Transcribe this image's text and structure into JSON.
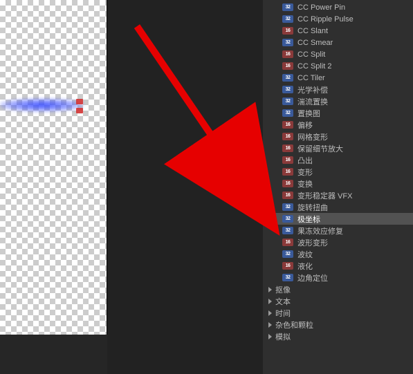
{
  "effects": [
    {
      "badge": "32",
      "label": "CC Power Pin"
    },
    {
      "badge": "32",
      "label": "CC Ripple Pulse"
    },
    {
      "badge": "16",
      "label": "CC Slant"
    },
    {
      "badge": "32",
      "label": "CC Smear"
    },
    {
      "badge": "16",
      "label": "CC Split"
    },
    {
      "badge": "16",
      "label": "CC Split 2"
    },
    {
      "badge": "32",
      "label": "CC Tiler"
    },
    {
      "badge": "32",
      "label": "光学补偿"
    },
    {
      "badge": "32",
      "label": "湍流置换"
    },
    {
      "badge": "32",
      "label": "置换图"
    },
    {
      "badge": "16",
      "label": "偏移"
    },
    {
      "badge": "16",
      "label": "网格变形"
    },
    {
      "badge": "16",
      "label": "保留细节放大"
    },
    {
      "badge": "16",
      "label": "凸出"
    },
    {
      "badge": "16",
      "label": "变形"
    },
    {
      "badge": "16",
      "label": "变换"
    },
    {
      "badge": "16",
      "label": "变形稳定器 VFX"
    },
    {
      "badge": "32",
      "label": "旋转扭曲"
    },
    {
      "badge": "32",
      "label": "极坐标",
      "selected": true
    },
    {
      "badge": "32",
      "label": "果冻效应修复"
    },
    {
      "badge": "16",
      "label": "波形变形"
    },
    {
      "badge": "32",
      "label": "波纹"
    },
    {
      "badge": "16",
      "label": "液化"
    },
    {
      "badge": "32",
      "label": "边角定位"
    }
  ],
  "categories": [
    {
      "label": "抠像"
    },
    {
      "label": "文本"
    },
    {
      "label": "时间"
    },
    {
      "label": "杂色和颗粒"
    },
    {
      "label": "模拟"
    }
  ],
  "badge_text": {
    "32": "32",
    "16": "16"
  }
}
